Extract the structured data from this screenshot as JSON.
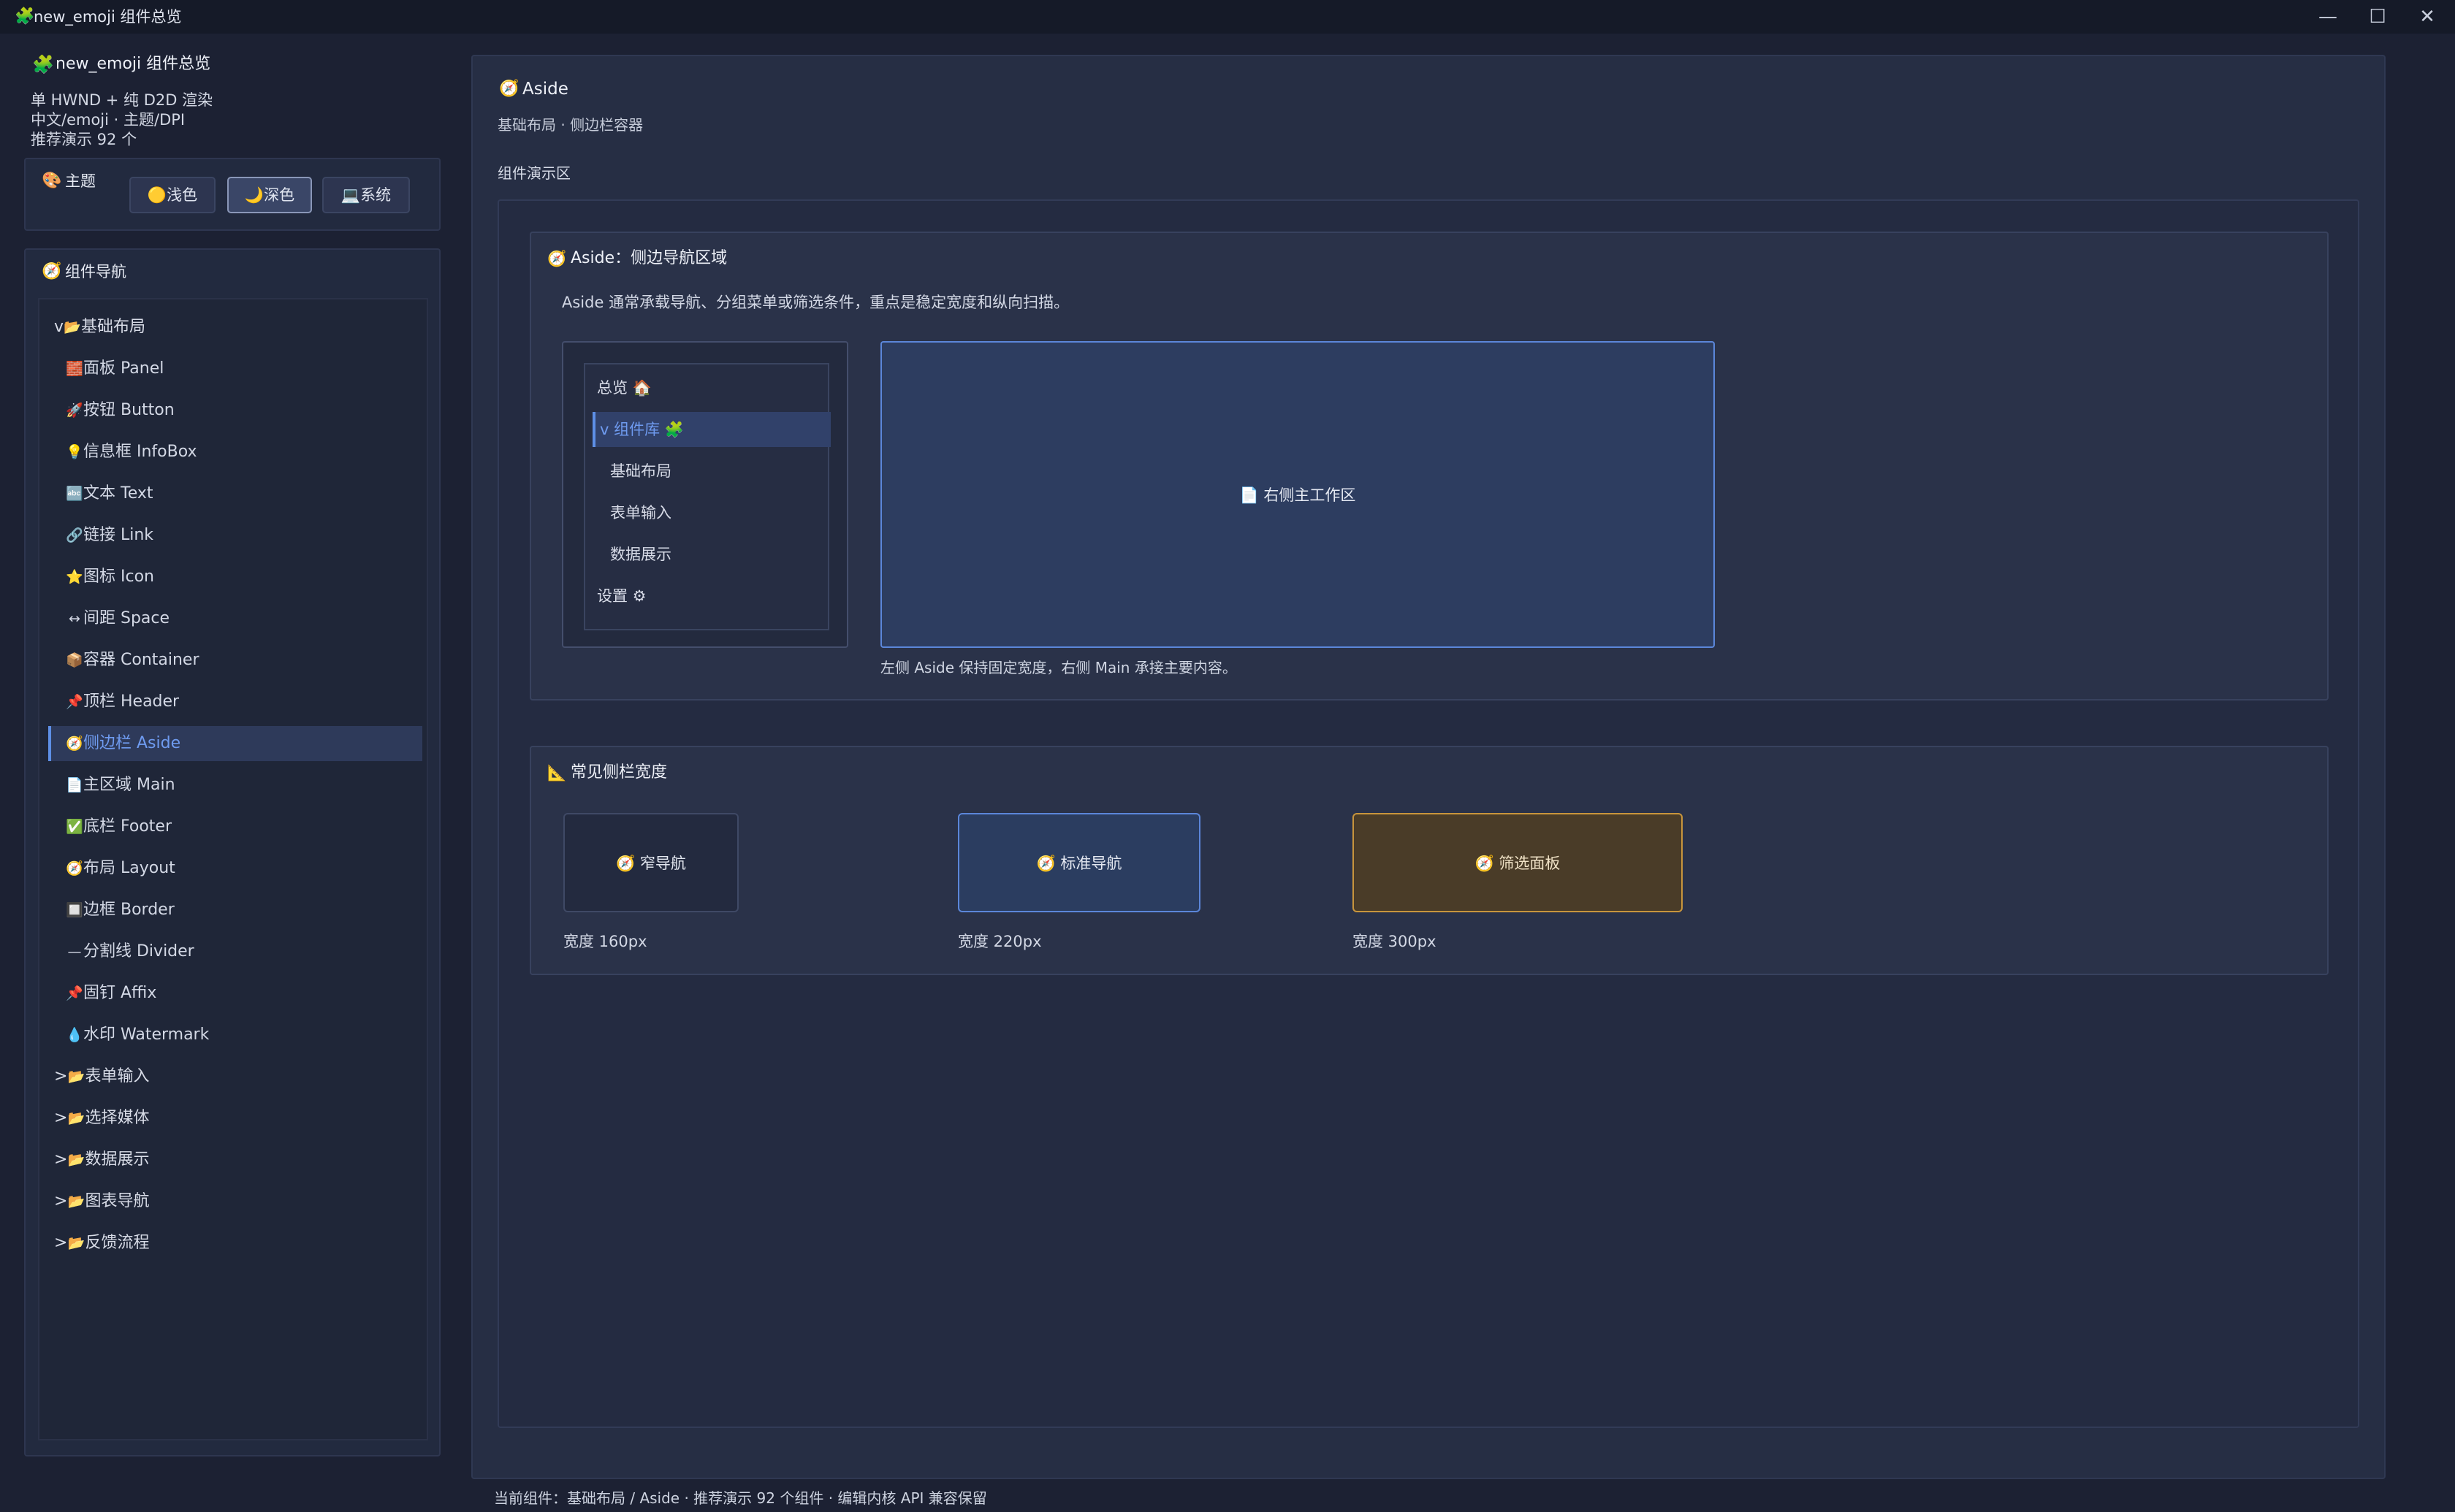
{
  "window": {
    "icon": "puzzle-icon",
    "icon_glyph": "🧩",
    "title": "new_emoji 组件总览",
    "controls": {
      "minimize": "—",
      "maximize": "☐",
      "close": "✕"
    }
  },
  "sidebar": {
    "app_icon_glyph": "🧩",
    "app_title": "new_emoji 组件总览",
    "info_lines": [
      "单 HWND + 纯 D2D 渲染",
      "中文/emoji · 主题/DPI",
      "推荐演示 92 个"
    ],
    "theme": {
      "icon_glyph": "🎨",
      "label": "主题",
      "buttons": [
        {
          "label": "🟡浅色",
          "active": false
        },
        {
          "label": "🌙深色",
          "active": true
        },
        {
          "label": "💻系统",
          "active": false
        }
      ]
    },
    "nav": {
      "icon_glyph": "🧭",
      "label": "组件导航",
      "items": [
        {
          "arrow": "v",
          "icon": "📂",
          "label": "基础布局",
          "folder": true
        },
        {
          "icon": "🧱",
          "label": "面板 Panel"
        },
        {
          "icon": "🚀",
          "label": "按钮 Button"
        },
        {
          "icon": "💡",
          "label": "信息框 InfoBox"
        },
        {
          "icon": "🔤",
          "label": "文本 Text"
        },
        {
          "icon": "🔗",
          "label": "链接 Link"
        },
        {
          "icon": "⭐",
          "label": "图标 Icon"
        },
        {
          "icon": "↔",
          "label": "间距 Space"
        },
        {
          "icon": "📦",
          "label": "容器 Container"
        },
        {
          "icon": "📌",
          "label": "顶栏 Header"
        },
        {
          "icon": "🧭",
          "label": "侧边栏 Aside",
          "active": true
        },
        {
          "icon": "📄",
          "label": "主区域 Main"
        },
        {
          "icon": "✅",
          "label": "底栏 Footer"
        },
        {
          "icon": "🧭",
          "label": "布局 Layout"
        },
        {
          "icon": "🔲",
          "label": "边框 Border"
        },
        {
          "icon": "—",
          "label": "分割线 Divider"
        },
        {
          "icon": "📌",
          "label": "固钉 Affix"
        },
        {
          "icon": "💧",
          "label": "水印 Watermark"
        },
        {
          "arrow": ">",
          "icon": "📂",
          "label": "表单输入",
          "folder": true
        },
        {
          "arrow": ">",
          "icon": "📂",
          "label": "选择媒体",
          "folder": true
        },
        {
          "arrow": ">",
          "icon": "📂",
          "label": "数据展示",
          "folder": true
        },
        {
          "arrow": ">",
          "icon": "📂",
          "label": "图表导航",
          "folder": true
        },
        {
          "arrow": ">",
          "icon": "📂",
          "label": "反馈流程",
          "folder": true
        }
      ]
    }
  },
  "main": {
    "title_icon": "🧭",
    "title": "Aside",
    "subtitle": "基础布局 · 侧边栏容器",
    "demo_label": "组件演示区",
    "section1": {
      "icon": "🧭",
      "title": "Aside：侧边导航区域",
      "desc": "Aside 通常承载导航、分组菜单或筛选条件，重点是稳定宽度和纵向扫描。",
      "mini_nav": [
        {
          "label": "总览 🏠",
          "kind": "top"
        },
        {
          "label": "v 组件库 🧩",
          "kind": "active"
        },
        {
          "label": "基础布局",
          "kind": "sub"
        },
        {
          "label": "表单输入",
          "kind": "sub"
        },
        {
          "label": "数据展示",
          "kind": "sub"
        },
        {
          "label": "设置 ⚙",
          "kind": "top"
        }
      ],
      "workarea_label": "📄 右侧主工作区",
      "note": "左侧 Aside 保持固定宽度，右侧 Main 承接主要内容。"
    },
    "section2": {
      "icon": "📐",
      "title": "常见侧栏宽度",
      "items": [
        {
          "label": "🧭 窄导航",
          "caption": "宽度 160px"
        },
        {
          "label": "🧭 标准导航",
          "caption": "宽度 220px"
        },
        {
          "label": "🧭 筛选面板",
          "caption": "宽度 300px"
        }
      ]
    }
  },
  "status": "当前组件：基础布局 / Aside · 推荐演示 92 个组件 · 编辑内核 API 兼容保留"
}
